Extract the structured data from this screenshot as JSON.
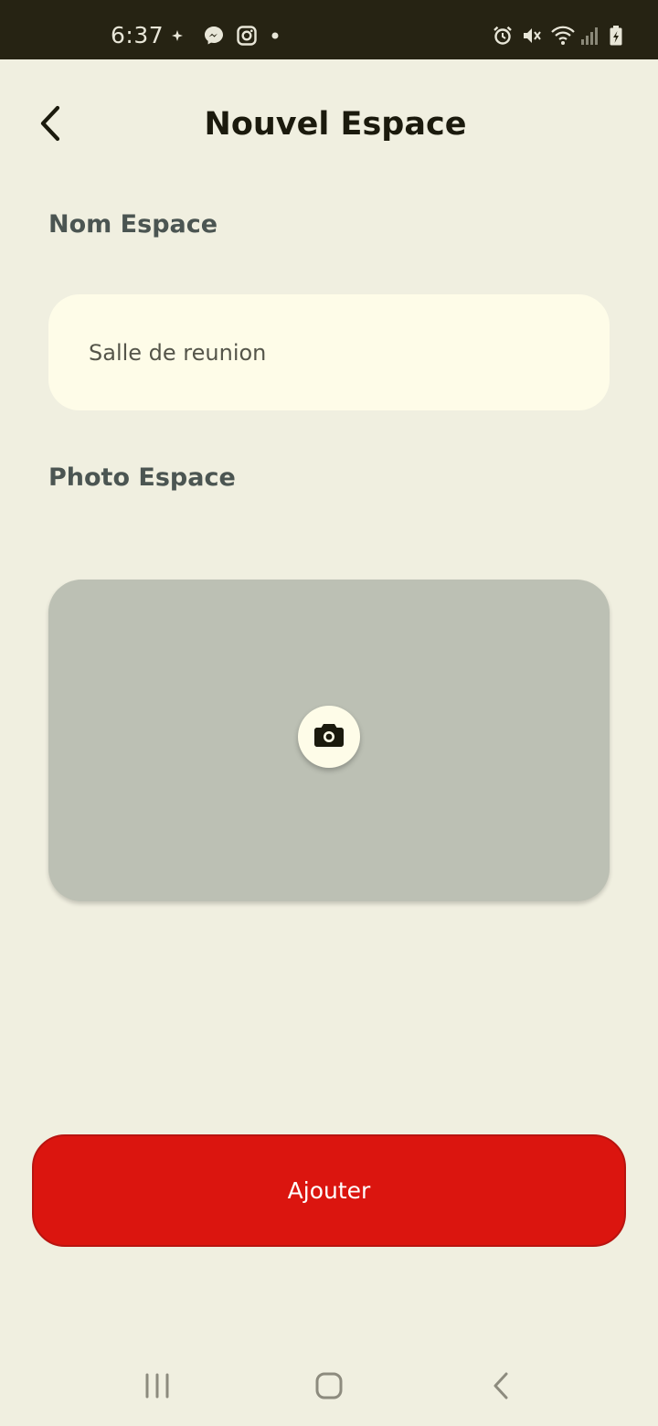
{
  "status_bar": {
    "time": "6:37",
    "left_icons": [
      "sparkle-icon",
      "messenger-icon",
      "instagram-icon",
      "dot-icon"
    ],
    "right_icons": [
      "alarm-icon",
      "mute-icon",
      "wifi-icon",
      "signal-icon",
      "battery-charging-icon"
    ]
  },
  "header": {
    "title": "Nouvel Espace",
    "back_icon": "chevron-left-icon"
  },
  "form": {
    "name_label": "Nom Espace",
    "name_value": "Salle de reunion",
    "photo_label": "Photo Espace",
    "camera_icon": "camera-icon"
  },
  "submit": {
    "label": "Ajouter"
  },
  "nav_bar": {
    "items": [
      "recents-icon",
      "home-icon",
      "back-icon"
    ]
  },
  "colors": {
    "background": "#f0efe0",
    "status_bar": "#262313",
    "input_bg": "#fefce8",
    "photo_bg": "#bcc0b4",
    "accent": "#db150f",
    "label": "#4b5552",
    "title": "#1b1a0d"
  }
}
